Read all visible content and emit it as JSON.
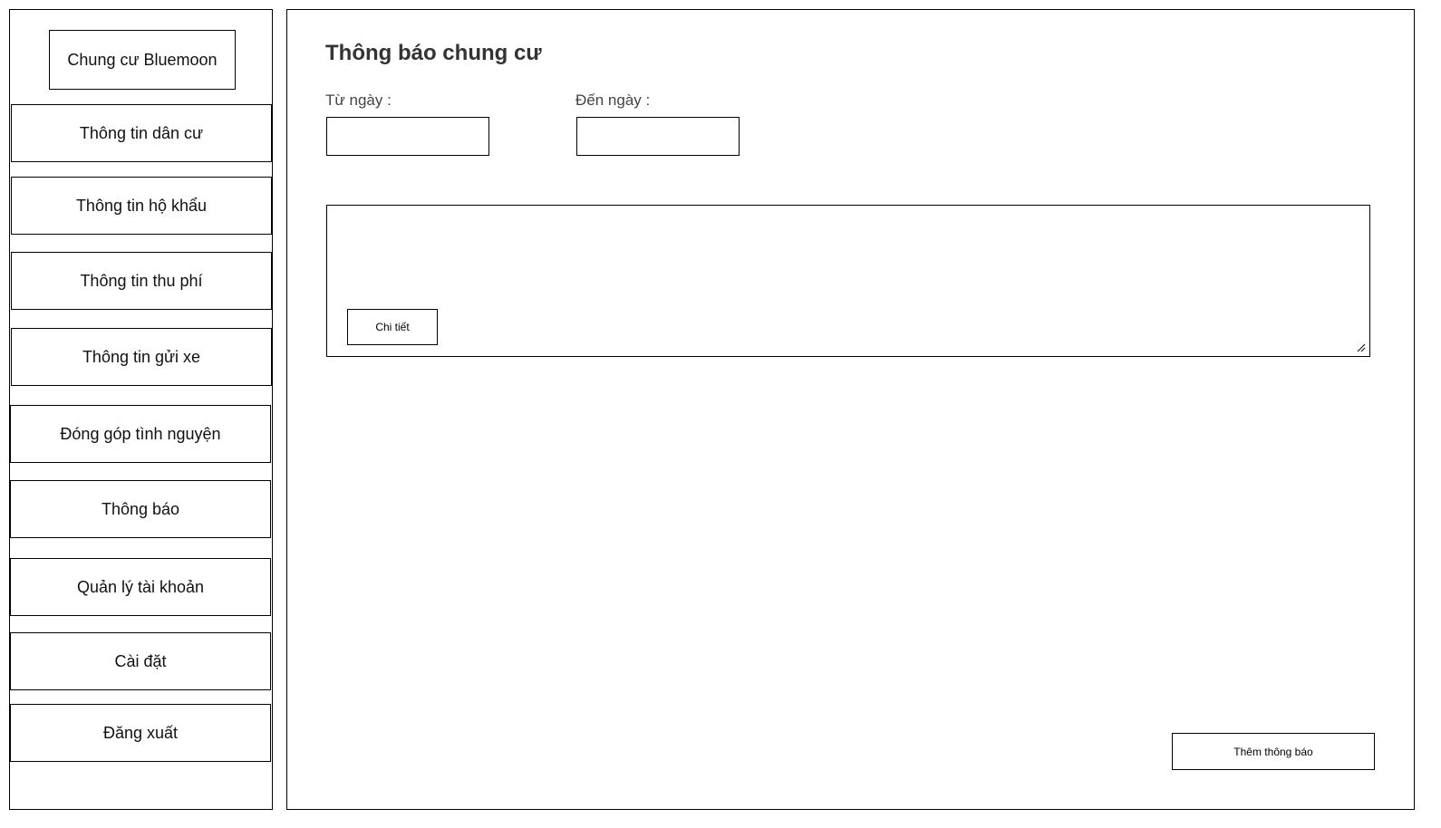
{
  "sidebar": {
    "brand": "Chung cư Bluemoon",
    "items": [
      {
        "label": "Thông tin dân cư"
      },
      {
        "label": "Thông tin hộ khẩu"
      },
      {
        "label": "Thông tin thu phí"
      },
      {
        "label": "Thông tin gửi xe"
      },
      {
        "label": "Đóng góp tình nguyện"
      },
      {
        "label": "Thông báo"
      },
      {
        "label": "Quản lý tài khoản"
      },
      {
        "label": "Cài đặt"
      },
      {
        "label": "Đăng xuất"
      }
    ]
  },
  "main": {
    "title": "Thông báo chung cư",
    "from_label": "Từ ngày :",
    "to_label": "Đến ngày :",
    "from_value": "",
    "to_value": "",
    "notice": {
      "details_button": "Chi tiết"
    },
    "add_button": "Thêm thông báo"
  }
}
